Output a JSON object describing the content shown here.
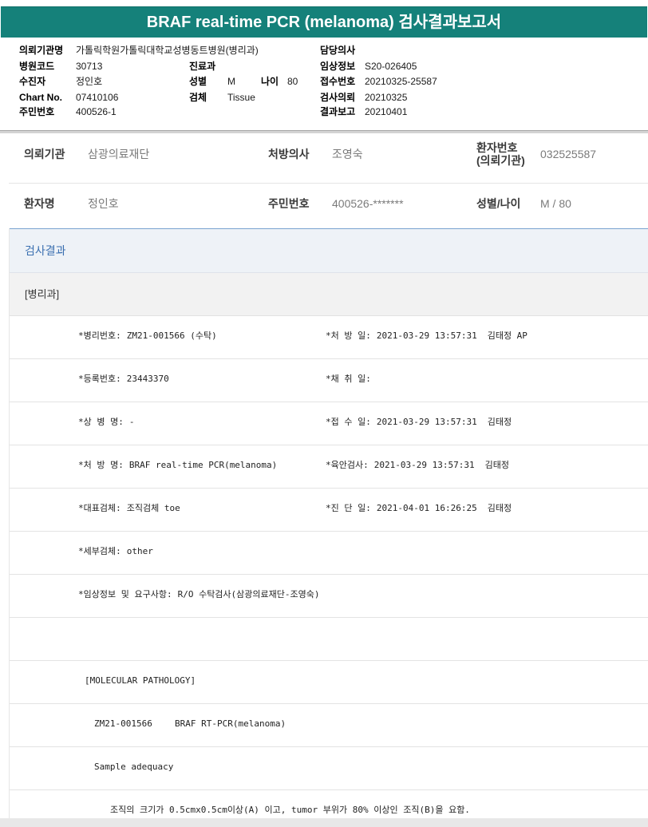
{
  "header": {
    "title": "BRAF real-time PCR (melanoma) 검사결과보고서"
  },
  "info": {
    "institution": {
      "label": "의뢰기관명",
      "value": "가톨릭학원가톨릭대학교성병동트병원(병리과)"
    },
    "attending": {
      "label": "담당의사"
    },
    "hospital_code": {
      "label": "병원코드",
      "value": "30713"
    },
    "department": {
      "label": "진료과"
    },
    "clinical_info": {
      "label": "임상정보",
      "value": "S20-026405"
    },
    "patient": {
      "label": "수진자",
      "value": "정인호"
    },
    "sex": {
      "label": "성별",
      "value": "M"
    },
    "age": {
      "label": "나이",
      "value": "80"
    },
    "receipt_no": {
      "label": "접수번호",
      "value": "20210325-25587"
    },
    "chart_no": {
      "label": "Chart No.",
      "value": "07410106"
    },
    "specimen": {
      "label": "검체",
      "value": "Tissue"
    },
    "request_date": {
      "label": "검사의뢰",
      "value": "20210325"
    },
    "resident_no": {
      "label": "주민번호",
      "value": "400526-1"
    },
    "report_date": {
      "label": "결과보고",
      "value": "20210401"
    }
  },
  "patient_panel": {
    "requesting_org": {
      "label": "의뢰기관",
      "value": "삼광의료재단"
    },
    "prescriber": {
      "label": "처방의사",
      "value": "조영숙"
    },
    "patient_no": {
      "label_line1": "환자번호",
      "label_line2": "(의뢰기관)",
      "value": "032525587"
    },
    "patient_name": {
      "label": "환자명",
      "value": "정인호"
    },
    "resident_no": {
      "label": "주민번호",
      "value": "400526-*******"
    },
    "sex_age": {
      "label": "성별/나이",
      "value": "M / 80"
    }
  },
  "results": {
    "title": "검사결과",
    "department_tag": "[병리과]",
    "details": [
      {
        "left": {
          "label": "*병리번호:",
          "value": "ZM21-001566 (수탁)"
        },
        "right": {
          "label": "*처 방 일:",
          "value": "2021-03-29 13:57:31",
          "staff": "김태정 AP"
        }
      },
      {
        "left": {
          "label": "*등록번호:",
          "value": "23443370"
        },
        "right": {
          "label": "*채 취 일:"
        }
      },
      {
        "left": {
          "label": "*상 병 명:",
          "value": "-"
        },
        "right": {
          "label": "*접 수 일:",
          "value": "2021-03-29 13:57:31",
          "staff": "김태정"
        }
      },
      {
        "left": {
          "label": "*처 방 명:",
          "value": "BRAF real-time PCR(melanoma)"
        },
        "right": {
          "label": "*육안검사:",
          "value": "2021-03-29 13:57:31",
          "staff": "김태정"
        }
      },
      {
        "left": {
          "label": "*대표검체:",
          "value": "조직검체 toe"
        },
        "right": {
          "label": "*진 단 일:",
          "value": "2021-04-01 16:26:25",
          "staff": "김태정"
        }
      },
      {
        "left": {
          "label": "*세부검체:",
          "value": "other"
        }
      },
      {
        "left": {
          "label": "*임상정보 및 요구사항:",
          "value": "R/O 수탁검사(삼광의료재단-조영숙)"
        }
      }
    ],
    "molecular": {
      "heading": "[MOLECULAR PATHOLOGY]",
      "case_no": "ZM21-001566",
      "test_name": "BRAF RT-PCR(melanoma)",
      "adequacy_title": "Sample adequacy",
      "adequacy_note": "조직의 크기가 0.5cmx0.5cm이상(A) 이고, tumor 부위가 80% 이상인 조직(B)을 요함."
    }
  },
  "theme": {
    "header_bg": "#15817a",
    "section_title": "#3a6fb0",
    "rule_line": "#7aa2d0"
  }
}
